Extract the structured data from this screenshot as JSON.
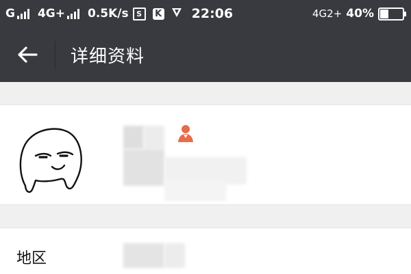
{
  "status_bar": {
    "carrier1": "G",
    "carrier2": "4G+",
    "speed": "0.5K/s",
    "s_badge": "S",
    "k_badge": "K",
    "time": "22:06",
    "network": "4G2+",
    "battery_percent": "40%",
    "battery_level": 0.4
  },
  "header": {
    "title": "详细资料"
  },
  "profile": {
    "gender_icon": "person-female-icon",
    "accent_color": "#e86b4a"
  },
  "region": {
    "label": "地区"
  }
}
